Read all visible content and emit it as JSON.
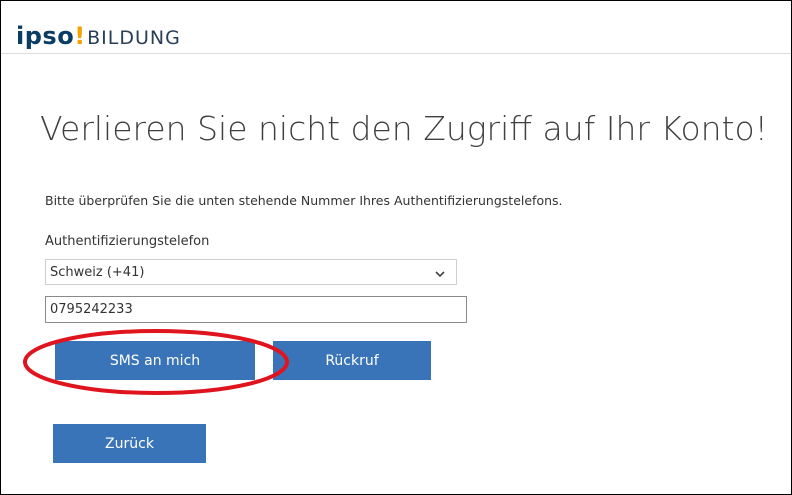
{
  "header": {
    "logo_brand": "ipso",
    "logo_mark": "!",
    "logo_sub": "BILDUNG"
  },
  "main": {
    "title": "Verlieren Sie nicht den Zugriff auf Ihr Konto!",
    "description": "Bitte überprüfen Sie die unten stehende Nummer Ihres Authentifizierungstelefons.",
    "phone_label": "Authentifizierungstelefon",
    "country_select": {
      "selected": "Schweiz (+41)"
    },
    "phone_input": {
      "value": "0795242233"
    },
    "buttons": {
      "sms": "SMS an mich",
      "callback": "Rückruf",
      "back": "Zurück"
    }
  },
  "colors": {
    "button": "#3a74b8",
    "highlight": "#e0141e",
    "brand": "#0b3c63",
    "brand_accent": "#f5a300"
  },
  "icons": [
    "chevron-down-icon"
  ]
}
